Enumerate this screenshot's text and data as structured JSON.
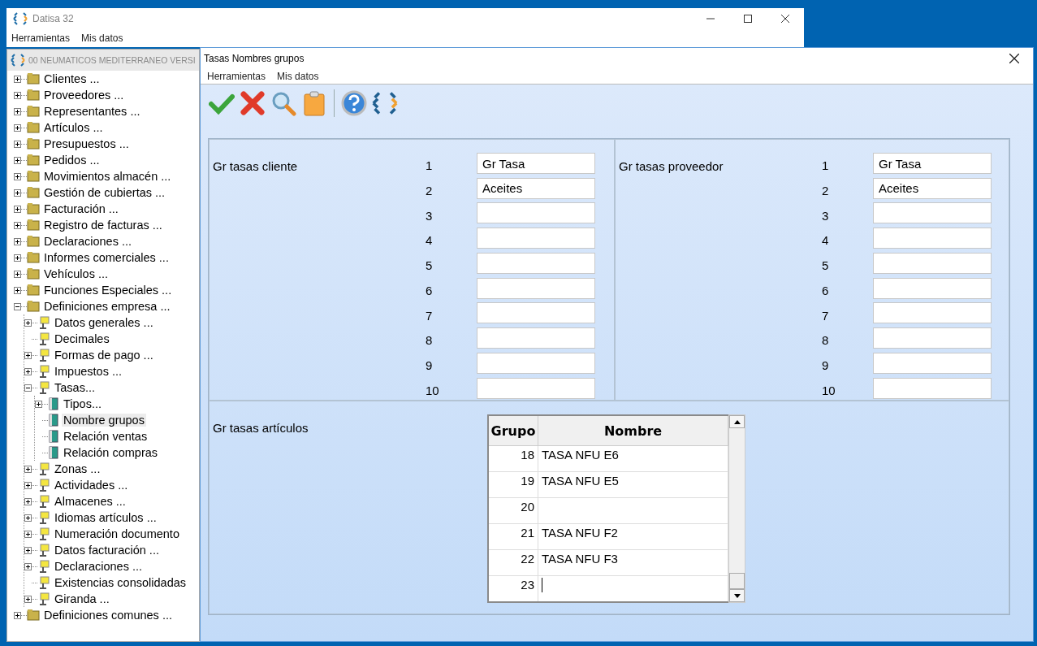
{
  "main_window": {
    "title": "Datisa 32",
    "menu": [
      "Herramientas",
      "Mis datos"
    ]
  },
  "tree_window": {
    "title": "00 NEUMATICOS MEDITERRANEO  VERSI",
    "items": [
      {
        "label": "Clientes ...",
        "kind": "branch",
        "expanded": false,
        "selected": false
      },
      {
        "label": "Proveedores ...",
        "kind": "branch",
        "expanded": false,
        "selected": false
      },
      {
        "label": "Representantes ...",
        "kind": "branch",
        "expanded": false,
        "selected": false
      },
      {
        "label": "Artículos ...",
        "kind": "branch",
        "expanded": false,
        "selected": false
      },
      {
        "label": "Presupuestos ...",
        "kind": "branch",
        "expanded": false,
        "selected": false
      },
      {
        "label": "Pedidos ...",
        "kind": "branch",
        "expanded": false,
        "selected": false
      },
      {
        "label": "Movimientos almacén ...",
        "kind": "branch",
        "expanded": false,
        "selected": false
      },
      {
        "label": "Gestión de cubiertas  ...",
        "kind": "branch",
        "expanded": false,
        "selected": false
      },
      {
        "label": "Facturación ...",
        "kind": "branch",
        "expanded": false,
        "selected": false
      },
      {
        "label": "Registro de facturas ...",
        "kind": "branch",
        "expanded": false,
        "selected": false
      },
      {
        "label": "Declaraciones ...",
        "kind": "branch",
        "expanded": false,
        "selected": false
      },
      {
        "label": "Informes comerciales ...",
        "kind": "branch",
        "expanded": false,
        "selected": false
      },
      {
        "label": "Vehículos ...",
        "kind": "branch",
        "expanded": false,
        "selected": false
      },
      {
        "label": "Funciones Especiales ...",
        "kind": "branch",
        "expanded": false,
        "selected": false
      },
      {
        "label": "Definiciones empresa ...",
        "kind": "branch",
        "expanded": true,
        "selected": false,
        "children": [
          {
            "label": "Datos generales ...",
            "kind": "branch",
            "expanded": false,
            "selected": false
          },
          {
            "label": "Decimales",
            "kind": "leaf",
            "selected": false
          },
          {
            "label": "Formas de pago ...",
            "kind": "branch",
            "expanded": false,
            "selected": false
          },
          {
            "label": "Impuestos ...",
            "kind": "branch",
            "expanded": false,
            "selected": false
          },
          {
            "label": "Tasas...",
            "kind": "branch",
            "expanded": true,
            "selected": false,
            "children": [
              {
                "label": "Tipos...",
                "kind": "branch",
                "expanded": false,
                "selected": false
              },
              {
                "label": "Nombre grupos",
                "kind": "leaf",
                "selected": true
              },
              {
                "label": "Relación ventas",
                "kind": "leaf",
                "selected": false
              },
              {
                "label": "Relación compras",
                "kind": "leaf",
                "selected": false
              }
            ]
          },
          {
            "label": "Zonas ...",
            "kind": "branch",
            "expanded": false,
            "selected": false
          },
          {
            "label": "Actividades ...",
            "kind": "branch",
            "expanded": false,
            "selected": false
          },
          {
            "label": "Almacenes ...",
            "kind": "branch",
            "expanded": false,
            "selected": false
          },
          {
            "label": "Idiomas artículos ...",
            "kind": "branch",
            "expanded": false,
            "selected": false
          },
          {
            "label": "Numeración documento",
            "kind": "branch",
            "expanded": false,
            "selected": false
          },
          {
            "label": "Datos facturación ...",
            "kind": "branch",
            "expanded": false,
            "selected": false
          },
          {
            "label": "Declaraciones ...",
            "kind": "branch",
            "expanded": false,
            "selected": false
          },
          {
            "label": "Existencias consolidadas",
            "kind": "leaf",
            "selected": false
          },
          {
            "label": "Giranda ...",
            "kind": "branch",
            "expanded": false,
            "selected": false
          }
        ]
      },
      {
        "label": "Definiciones comunes ...",
        "kind": "branch",
        "expanded": false,
        "selected": false
      }
    ]
  },
  "dialog": {
    "title": "Tasas Nombres grupos",
    "menu": [
      "Herramientas",
      "Mis datos"
    ],
    "client_groups": {
      "label": "Gr tasas cliente",
      "fields": [
        {
          "number": "1",
          "value": "Gr Tasa"
        },
        {
          "number": "2",
          "value": "Aceites"
        },
        {
          "number": "3"
        },
        {
          "number": "4"
        },
        {
          "number": "5"
        },
        {
          "number": "6"
        },
        {
          "number": "7"
        },
        {
          "number": "8"
        },
        {
          "number": "9"
        },
        {
          "number": "10"
        }
      ]
    },
    "supplier_groups": {
      "label": "Gr tasas proveedor",
      "fields": [
        {
          "number": "1",
          "value": "Gr Tasa"
        },
        {
          "number": "2",
          "value": "Aceites"
        },
        {
          "number": "3"
        },
        {
          "number": "4"
        },
        {
          "number": "5"
        },
        {
          "number": "6"
        },
        {
          "number": "7"
        },
        {
          "number": "8"
        },
        {
          "number": "9"
        },
        {
          "number": "10"
        }
      ]
    },
    "article_groups": {
      "label": "Gr tasas artículos",
      "columns": [
        "Grupo",
        "Nombre"
      ],
      "rows": [
        {
          "grupo": "18",
          "nombre": "TASA NFU E6",
          "editing": false
        },
        {
          "grupo": "19",
          "nombre": "TASA NFU E5",
          "editing": false
        },
        {
          "grupo": "20",
          "editing": false
        },
        {
          "grupo": "21",
          "nombre": "TASA NFU F2",
          "editing": false
        },
        {
          "grupo": "22",
          "nombre": "TASA NFU F3",
          "editing": false
        },
        {
          "grupo": "23",
          "editing": true
        }
      ]
    }
  }
}
